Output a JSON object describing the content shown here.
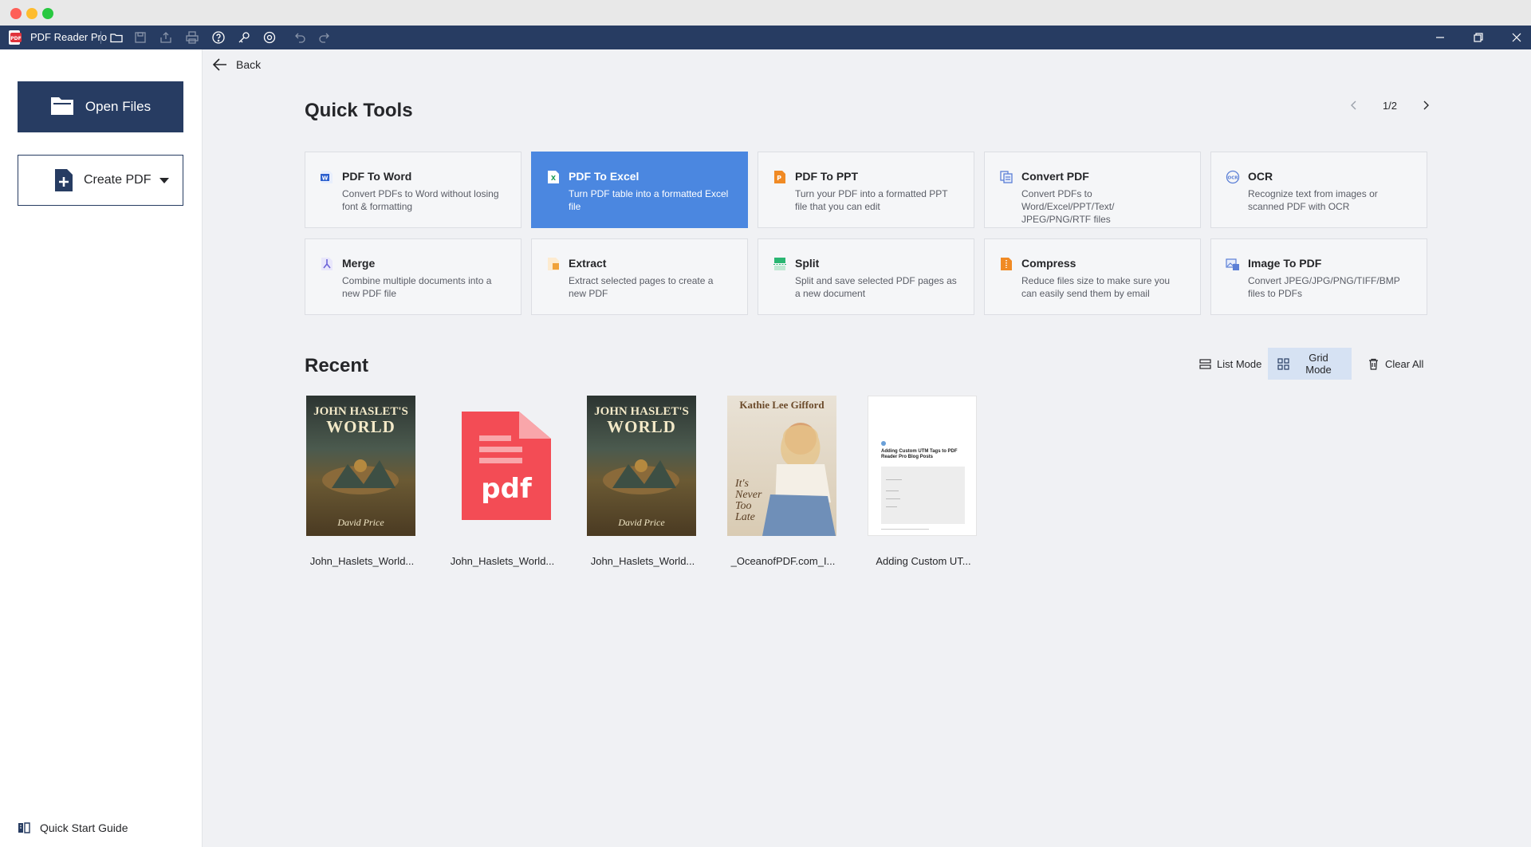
{
  "window": {
    "app_name": "PDF Reader Pro"
  },
  "sidebar": {
    "open_files_label": "Open Files",
    "create_pdf_label": "Create PDF",
    "quick_start_label": "Quick Start Guide"
  },
  "nav": {
    "back_label": "Back"
  },
  "quick_tools": {
    "title": "Quick Tools",
    "pager": "1/2",
    "tools": [
      {
        "name": "PDF To Word",
        "desc": "Convert PDFs to Word without losing font & formatting",
        "icon": "word-icon",
        "color": "#2b5fce"
      },
      {
        "name": "PDF To Excel",
        "desc": "Turn PDF table into a formatted Excel file",
        "icon": "excel-icon",
        "color": "#1f9e5a"
      },
      {
        "name": "PDF To PPT",
        "desc": "Turn your PDF into a formatted PPT file that you can edit",
        "icon": "ppt-icon",
        "color": "#f08a24"
      },
      {
        "name": "Convert PDF",
        "desc": "Convert PDFs to Word/Excel/PPT/Text/ JPEG/PNG/RTF files",
        "icon": "convert-icon",
        "color": "#5b7fd6"
      },
      {
        "name": "OCR",
        "desc": "Recognize text from images or scanned PDF with OCR",
        "icon": "ocr-icon",
        "color": "#5b7fd6"
      },
      {
        "name": "Merge",
        "desc": "Combine multiple documents into a new PDF file",
        "icon": "merge-icon",
        "color": "#6c63d8"
      },
      {
        "name": "Extract",
        "desc": "Extract selected pages to create a new PDF",
        "icon": "extract-icon",
        "color": "#f0a23a"
      },
      {
        "name": "Split",
        "desc": "Split and save selected PDF pages as a new document",
        "icon": "split-icon",
        "color": "#2bb673"
      },
      {
        "name": "Compress",
        "desc": "Reduce files size to make sure you can easily send them by email",
        "icon": "compress-icon",
        "color": "#f08a24"
      },
      {
        "name": "Image To PDF",
        "desc": "Convert JPEG/JPG/PNG/TIFF/BMP files to PDFs",
        "icon": "image-icon",
        "color": "#5b7fd6"
      }
    ],
    "active_tool": "PDF To Excel"
  },
  "recent": {
    "title": "Recent",
    "list_mode_label": "List Mode",
    "grid_mode_label": "Grid Mode",
    "clear_all_label": "Clear All",
    "selected_mode": "Grid Mode",
    "files": [
      {
        "name": "John_Haslets_World...",
        "thumb": "book-cover"
      },
      {
        "name": "John_Haslets_World...",
        "thumb": "pdf-file-icon"
      },
      {
        "name": "John_Haslets_World...",
        "thumb": "book-cover"
      },
      {
        "name": "_OceanofPDF.com_I...",
        "thumb": "kathie-cover"
      },
      {
        "name": "Adding Custom UT...",
        "thumb": "document-page"
      }
    ],
    "covers": {
      "book": {
        "line1": "JOHN HASLET'S",
        "line2": "WORLD",
        "author": "David Price"
      },
      "kathie": {
        "author": "Kathie Lee Gifford",
        "title_lines": [
          "It's",
          "Never",
          "Too",
          "Late"
        ]
      },
      "doc": {
        "heading": "Adding Custom UTM Tags to PDF Reader Pro Blog Posts"
      },
      "pdf_label": "pdf"
    }
  },
  "colors": {
    "titlebar": "#273c62",
    "accent": "#4b87e0",
    "selected_mode_bg": "#d6e2f3"
  }
}
